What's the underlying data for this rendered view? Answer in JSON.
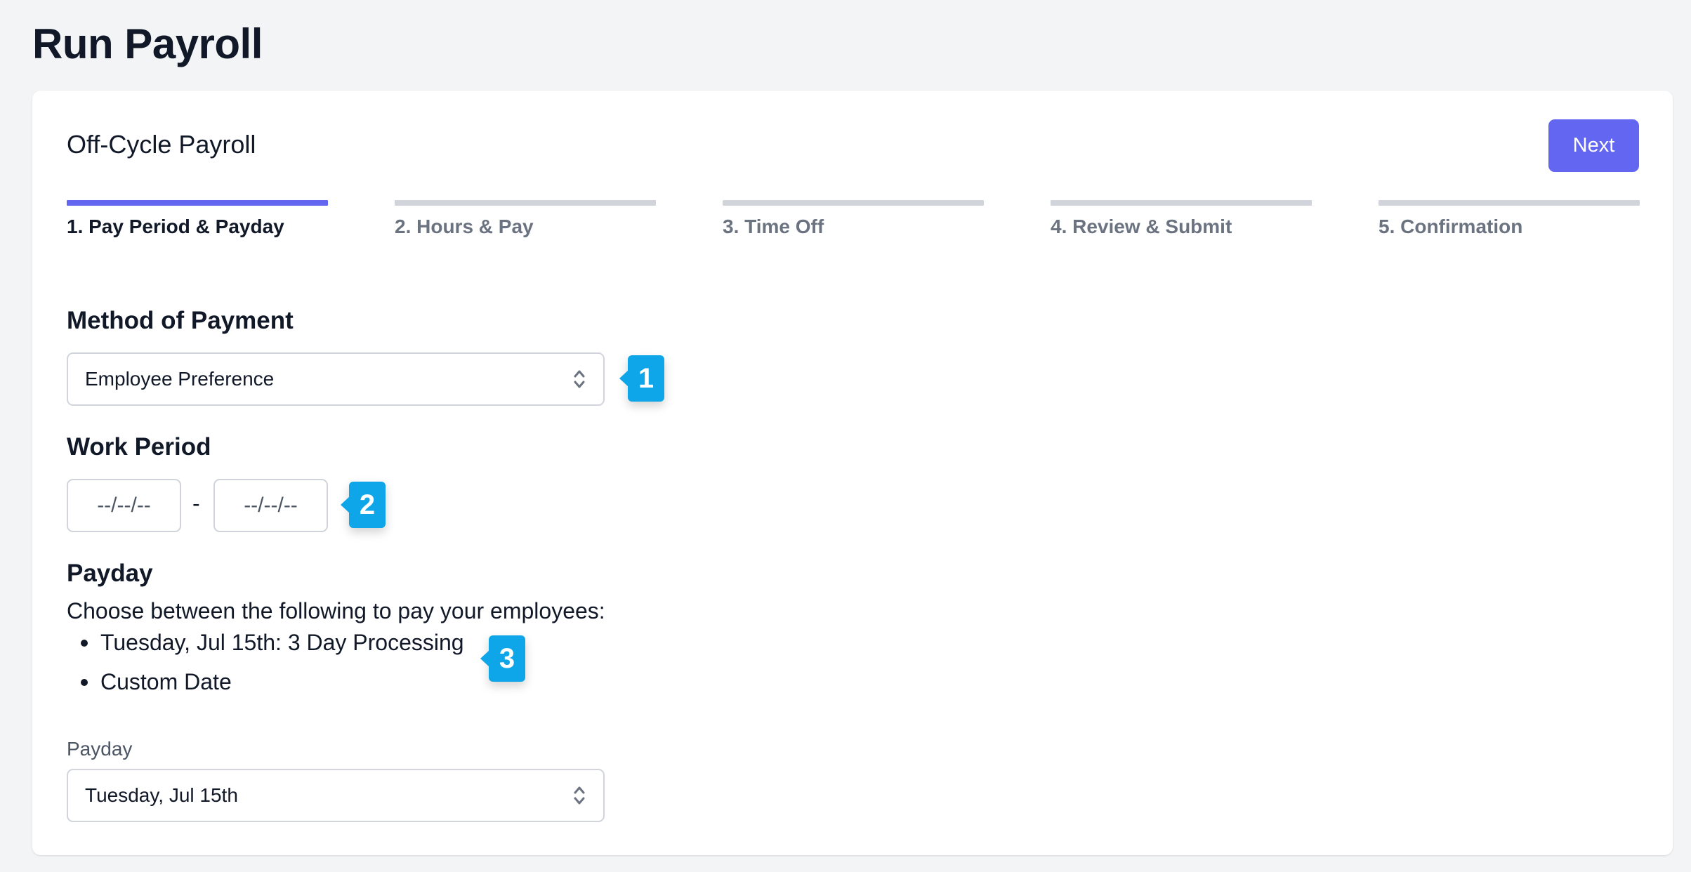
{
  "page": {
    "title": "Run Payroll"
  },
  "card": {
    "title": "Off-Cycle Payroll",
    "next_label": "Next"
  },
  "steps": [
    {
      "label": "1. Pay Period & Payday",
      "active": true
    },
    {
      "label": "2. Hours & Pay",
      "active": false
    },
    {
      "label": "3. Time Off",
      "active": false
    },
    {
      "label": "4. Review & Submit",
      "active": false
    },
    {
      "label": "5. Confirmation",
      "active": false
    }
  ],
  "method_of_payment": {
    "label": "Method of Payment",
    "selected": "Employee Preference",
    "icon": "chevron-up-down-icon"
  },
  "work_period": {
    "label": "Work Period",
    "start_placeholder": "--/--/--",
    "separator": "-",
    "end_placeholder": "--/--/--"
  },
  "payday": {
    "label": "Payday",
    "description": "Choose between the following to pay your employees:",
    "options": [
      "Tuesday, Jul 15th: 3 Day Processing",
      "Custom Date"
    ],
    "field_label": "Payday",
    "selected": "Tuesday, Jul 15th"
  },
  "callouts": [
    "1",
    "2",
    "3"
  ],
  "colors": {
    "accent": "#6366f1",
    "callout": "#0ea5e9",
    "inactive_step": "#d1d5db"
  }
}
